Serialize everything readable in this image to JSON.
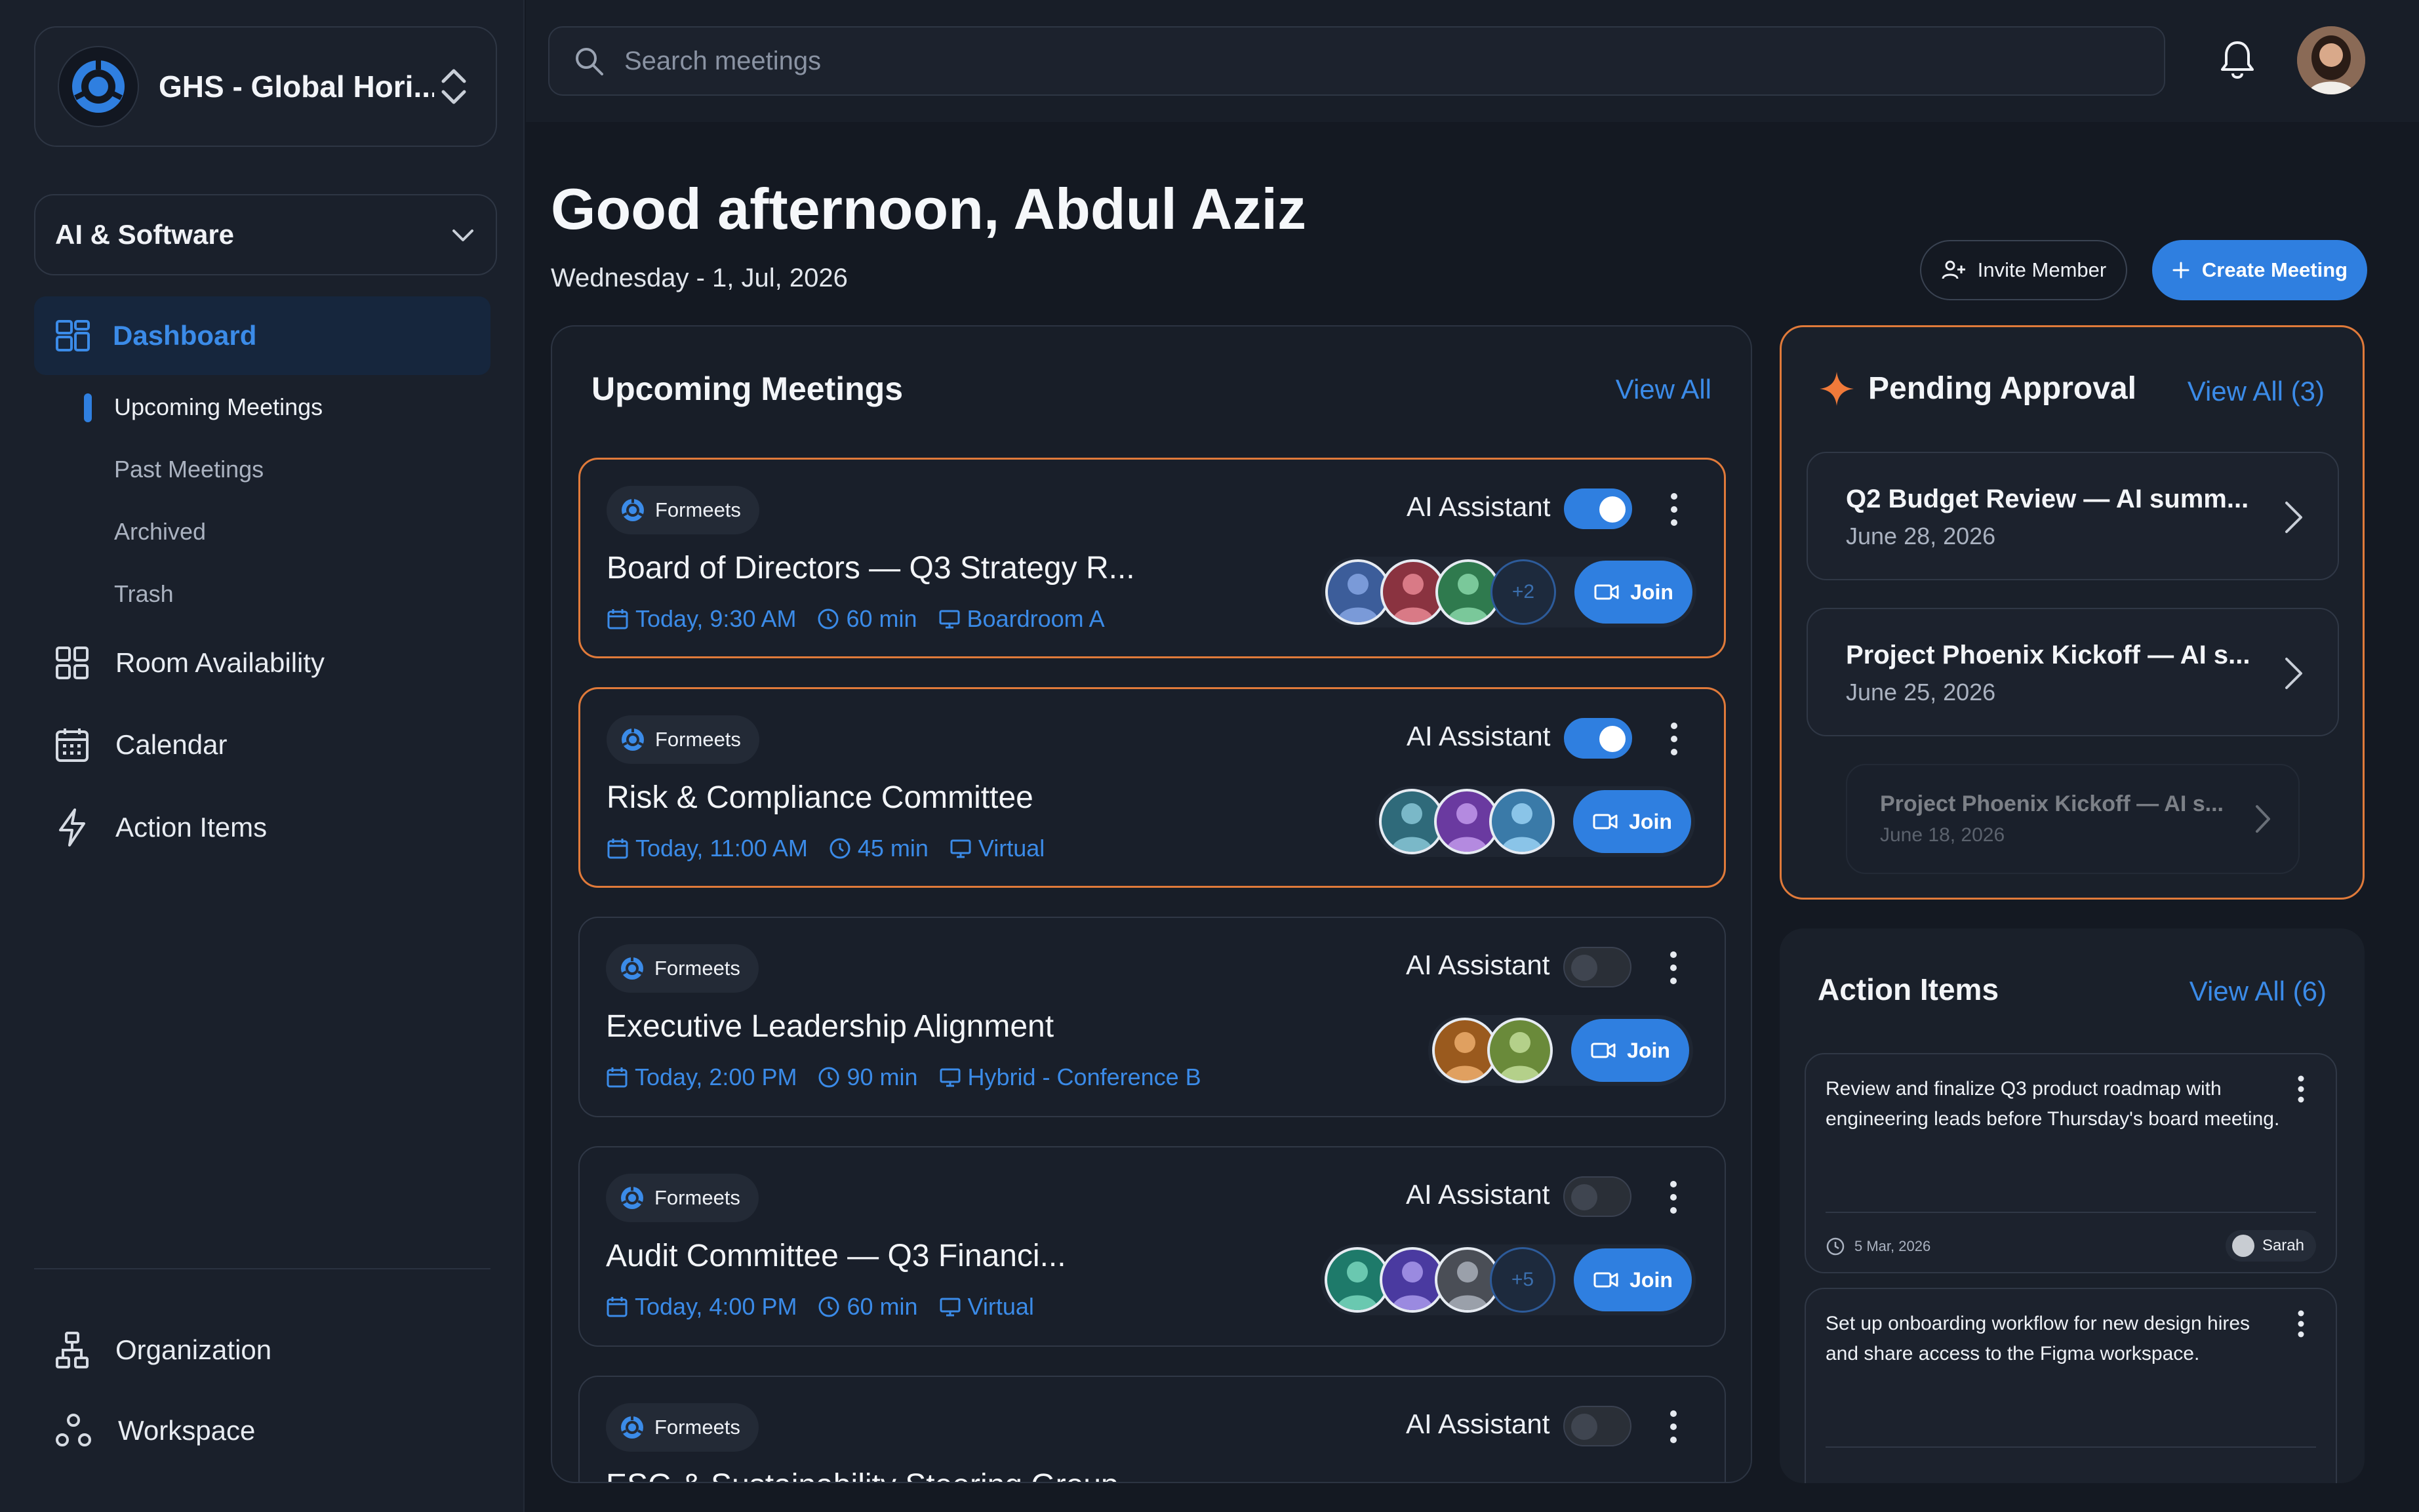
{
  "org": {
    "name": "GHS - Global Hori..."
  },
  "category": {
    "selected": "AI & Software"
  },
  "nav": {
    "dashboard": "Dashboard",
    "sub": [
      "Upcoming Meetings",
      "Past Meetings",
      "Archived",
      "Trash"
    ],
    "room": "Room Availability",
    "calendar": "Calendar",
    "actions": "Action Items",
    "organization": "Organization",
    "workspace": "Workspace"
  },
  "search": {
    "placeholder": "Search meetings"
  },
  "header": {
    "greeting": "Good afternoon, Abdul Aziz",
    "date": "Wednesday - 1, Jul, 2026",
    "invite_label": "Invite Member",
    "create_label": "Create Meeting"
  },
  "upcoming": {
    "title": "Upcoming Meetings",
    "view_all": "View All",
    "ai_label": "AI Assistant",
    "join_label": "Join",
    "meetings": [
      {
        "source": "Formeets",
        "title": "Board of Directors — Q3 Strategy R...",
        "time": "Today, 9:30 AM",
        "duration": "60 min",
        "location": "Boardroom A",
        "ai_on": true,
        "highlight": true,
        "more": "+2"
      },
      {
        "source": "Formeets",
        "title": "Risk & Compliance Committee",
        "time": "Today, 11:00 AM",
        "duration": "45 min",
        "location": "Virtual",
        "ai_on": true,
        "highlight": true,
        "more": ""
      },
      {
        "source": "Formeets",
        "title": "Executive Leadership Alignment",
        "time": "Today, 2:00 PM",
        "duration": "90 min",
        "location": "Hybrid - Conference B",
        "ai_on": false,
        "highlight": false,
        "more": ""
      },
      {
        "source": "Formeets",
        "title": "Audit Committee — Q3 Financi...",
        "time": "Today, 4:00 PM",
        "duration": "60 min",
        "location": "Virtual",
        "ai_on": false,
        "highlight": false,
        "more": "+5"
      },
      {
        "source": "Formeets",
        "title": "ESG & Sustainability Steering Group",
        "time": "",
        "duration": "",
        "location": "",
        "ai_on": false,
        "highlight": false,
        "more": ""
      }
    ]
  },
  "pending": {
    "title": "Pending Approval",
    "view_all": "View All (3)",
    "items": [
      {
        "title": "Q2 Budget Review — AI summ...",
        "date": "June 28, 2026"
      },
      {
        "title": "Project Phoenix Kickoff — AI s...",
        "date": "June 25, 2026"
      },
      {
        "title": "Project Phoenix Kickoff — AI s...",
        "date": "June 18, 2026"
      }
    ]
  },
  "action_items": {
    "title": "Action Items",
    "view_all": "View All (6)",
    "items": [
      {
        "text": "Review and finalize Q3 product roadmap with engineering leads before Thursday's board meeting.",
        "due": "5 Mar, 2026",
        "owner": "Sarah"
      },
      {
        "text": "Set up onboarding workflow for new design hires and share access to the Figma workspace.",
        "due": "",
        "owner": ""
      }
    ]
  },
  "colors": {
    "accent": "#2f7fe0",
    "highlight_border": "#e07a3a",
    "background": "#141922",
    "sparkle": "#f07a3a"
  }
}
